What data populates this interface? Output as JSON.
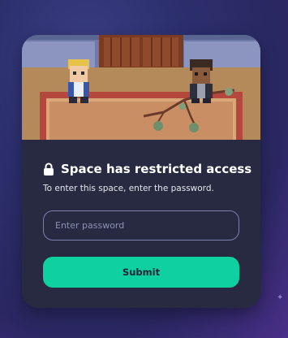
{
  "modal": {
    "title": "Space has restricted access",
    "subtitle": "To enter this space, enter the password.",
    "password_placeholder": "Enter password",
    "submit_label": "Submit"
  },
  "icons": {
    "title_icon": "lock-icon",
    "background_decoration": "sparkle-icon"
  },
  "colors": {
    "modal_background": "#272a40",
    "accent": "#0fd0a0",
    "input_border": "#7b80ad",
    "page_background": "#2c2f6c"
  }
}
